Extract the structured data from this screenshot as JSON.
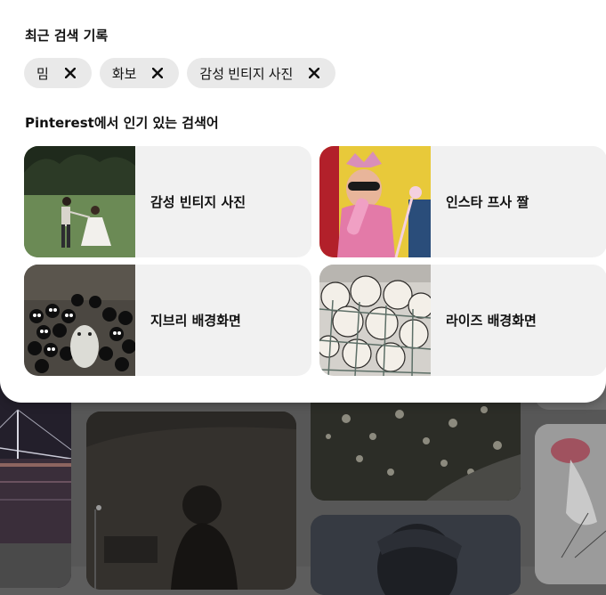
{
  "recent_searches": {
    "title": "최근 검색 기록",
    "items": [
      {
        "label": "밈"
      },
      {
        "label": "화보"
      },
      {
        "label": "감성 빈티지 사진"
      }
    ]
  },
  "popular_searches": {
    "title": "Pinterest에서 인기 있는 검색어",
    "items": [
      {
        "label": "감성 빈티지 사진"
      },
      {
        "label": "인스타 프사 짤"
      },
      {
        "label": "지브리 배경화면"
      },
      {
        "label": "라이즈 배경화면"
      }
    ]
  }
}
